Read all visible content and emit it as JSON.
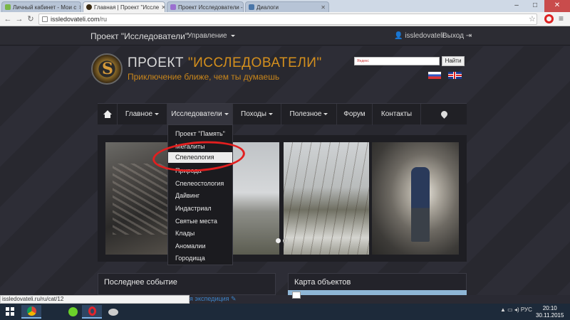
{
  "browser": {
    "tabs": [
      {
        "label": "Личный кабинет - Мои с",
        "favicon_color": "#7ab648"
      },
      {
        "label": "Главная | Проект \"Иссле",
        "favicon_color": "#3a2a12"
      },
      {
        "label": "Проект Исследователи -",
        "favicon_color": "#9b6fd0"
      },
      {
        "label": "Диалоги",
        "favicon_color": "#4a76a8"
      }
    ],
    "url_host": "issledovateli.com",
    "url_path": "/ru",
    "status_url": "issledovateli.ru/ru/cat/12"
  },
  "sitenav": {
    "brand": "Проект \"Исследователи\"",
    "management": "Управление",
    "user": "issledovateli",
    "logout": "Выход"
  },
  "header": {
    "title_prefix": "ПРОЕКТ ",
    "title_highlight": "\"ИССЛЕДОВАТЕЛИ\"",
    "subtitle": "Приключение ближе, чем ты думаешь",
    "search_placeholder": "Яндекс",
    "search_button": "Найти"
  },
  "menu": {
    "main": "Главное",
    "explorers": "Исследователи",
    "hikes": "Походы",
    "useful": "Полезное",
    "forum": "Форум",
    "contacts": "Контакты"
  },
  "dropdown": {
    "items": [
      "Проект \"Память\"",
      "Мегалиты",
      "Спелеология",
      "Природа",
      "Спелеостология",
      "Дайвинг",
      "Индастриал",
      "Святые места",
      "Клады",
      "Аномалии",
      "Городища"
    ],
    "hovered_index": 2
  },
  "panels": {
    "last_event": "Последнее событие",
    "map": "Карта объектов",
    "expedition_partial": "я экспедиция"
  },
  "taskbar": {
    "lang": "РУС",
    "time": "20:10",
    "date": "30.11.2015"
  }
}
